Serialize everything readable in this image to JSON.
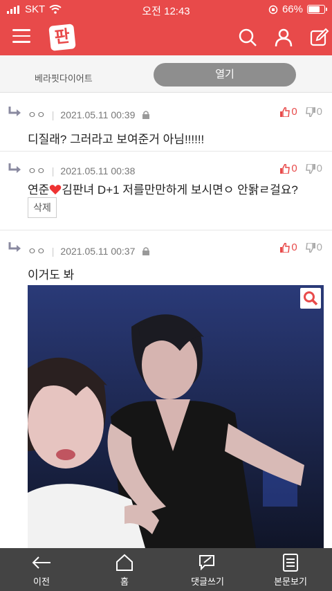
{
  "status": {
    "carrier": "SKT",
    "time": "오전 12:43",
    "battery": "66%",
    "battery_level": 0.66
  },
  "app": {
    "logo": "판",
    "accent": "#e84a4a"
  },
  "ad": {
    "name": "베라핏다이어트",
    "open_label": "열기"
  },
  "comments": [
    {
      "author": "ㅇㅇ",
      "date": "2021.05.11 00:39",
      "up": "0",
      "down": "0",
      "text": "디질래? 그러라고 보여준거 아님!!!!!!"
    },
    {
      "author": "ㅇㅇ",
      "date": "2021.05.11 00:38",
      "up": "0",
      "down": "0",
      "text_before": "연준",
      "text_after": "김판녀 D+1 저를만만하게 보시면ㅇ 안돩ㄹ걸요?",
      "delete_label": "삭제"
    },
    {
      "author": "ㅇㅇ",
      "date": "2021.05.11 00:37",
      "up": "0",
      "down": "0",
      "text": "이거도 봐"
    }
  ],
  "bottom_nav": [
    {
      "label": "이전",
      "icon": "back-arrow-icon"
    },
    {
      "label": "홈",
      "icon": "home-icon"
    },
    {
      "label": "댓글쓰기",
      "icon": "write-comment-icon"
    },
    {
      "label": "본문보기",
      "icon": "document-icon"
    }
  ]
}
